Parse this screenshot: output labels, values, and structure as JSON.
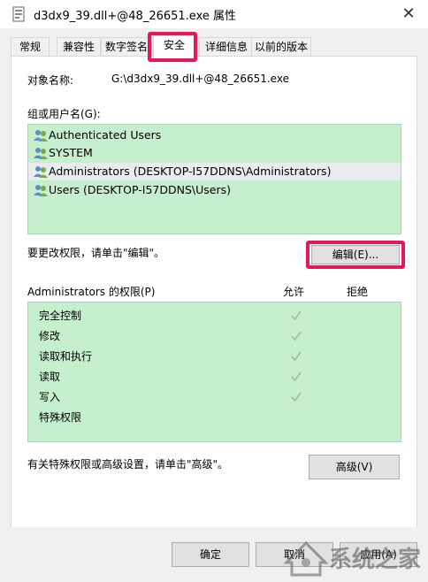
{
  "window": {
    "title": "d3dx9_39.dll+@48_26651.exe 属性",
    "close_glyph": "✕"
  },
  "tabs": [
    {
      "label": "常规",
      "active": false
    },
    {
      "label": "兼容性",
      "active": false
    },
    {
      "label": "数字签名",
      "active": false
    },
    {
      "label": "安全",
      "active": true
    },
    {
      "label": "详细信息",
      "active": false
    },
    {
      "label": "以前的版本",
      "active": false
    }
  ],
  "security": {
    "object_name_label": "对象名称:",
    "object_name_value": "G:\\d3dx9_39.dll+@48_26651.exe",
    "group_label": "组或用户名(G):",
    "users": [
      {
        "name": "Authenticated Users",
        "icon": "users-icon"
      },
      {
        "name": "SYSTEM",
        "icon": "users-icon"
      },
      {
        "name": "Administrators (DESKTOP-I57DDNS\\Administrators)",
        "icon": "users-icon",
        "selected": true
      },
      {
        "name": "Users (DESKTOP-I57DDNS\\Users)",
        "icon": "users-icon"
      }
    ],
    "edit_hint": "要更改权限，请单击\"编辑\"。",
    "edit_button": "编辑(E)...",
    "perm_label": "Administrators 的权限(P)",
    "allow_header": "允许",
    "deny_header": "拒绝",
    "permissions": [
      {
        "name": "完全控制",
        "allow": true,
        "deny": false
      },
      {
        "name": "修改",
        "allow": true,
        "deny": false
      },
      {
        "name": "读取和执行",
        "allow": true,
        "deny": false
      },
      {
        "name": "读取",
        "allow": true,
        "deny": false
      },
      {
        "name": "写入",
        "allow": true,
        "deny": false
      },
      {
        "name": "特殊权限",
        "allow": false,
        "deny": false
      }
    ],
    "advanced_hint": "有关特殊权限或高级设置，请单击\"高级\"。",
    "advanced_button": "高级(V)"
  },
  "footer": {
    "ok_button": "确定",
    "cancel_button": "取消",
    "apply_button": "应用(A)"
  },
  "watermark": {
    "text": "系统之家"
  },
  "colors": {
    "highlight": "#e8165e",
    "list_bg": "#c6efce",
    "check": "#b0b0b0"
  }
}
